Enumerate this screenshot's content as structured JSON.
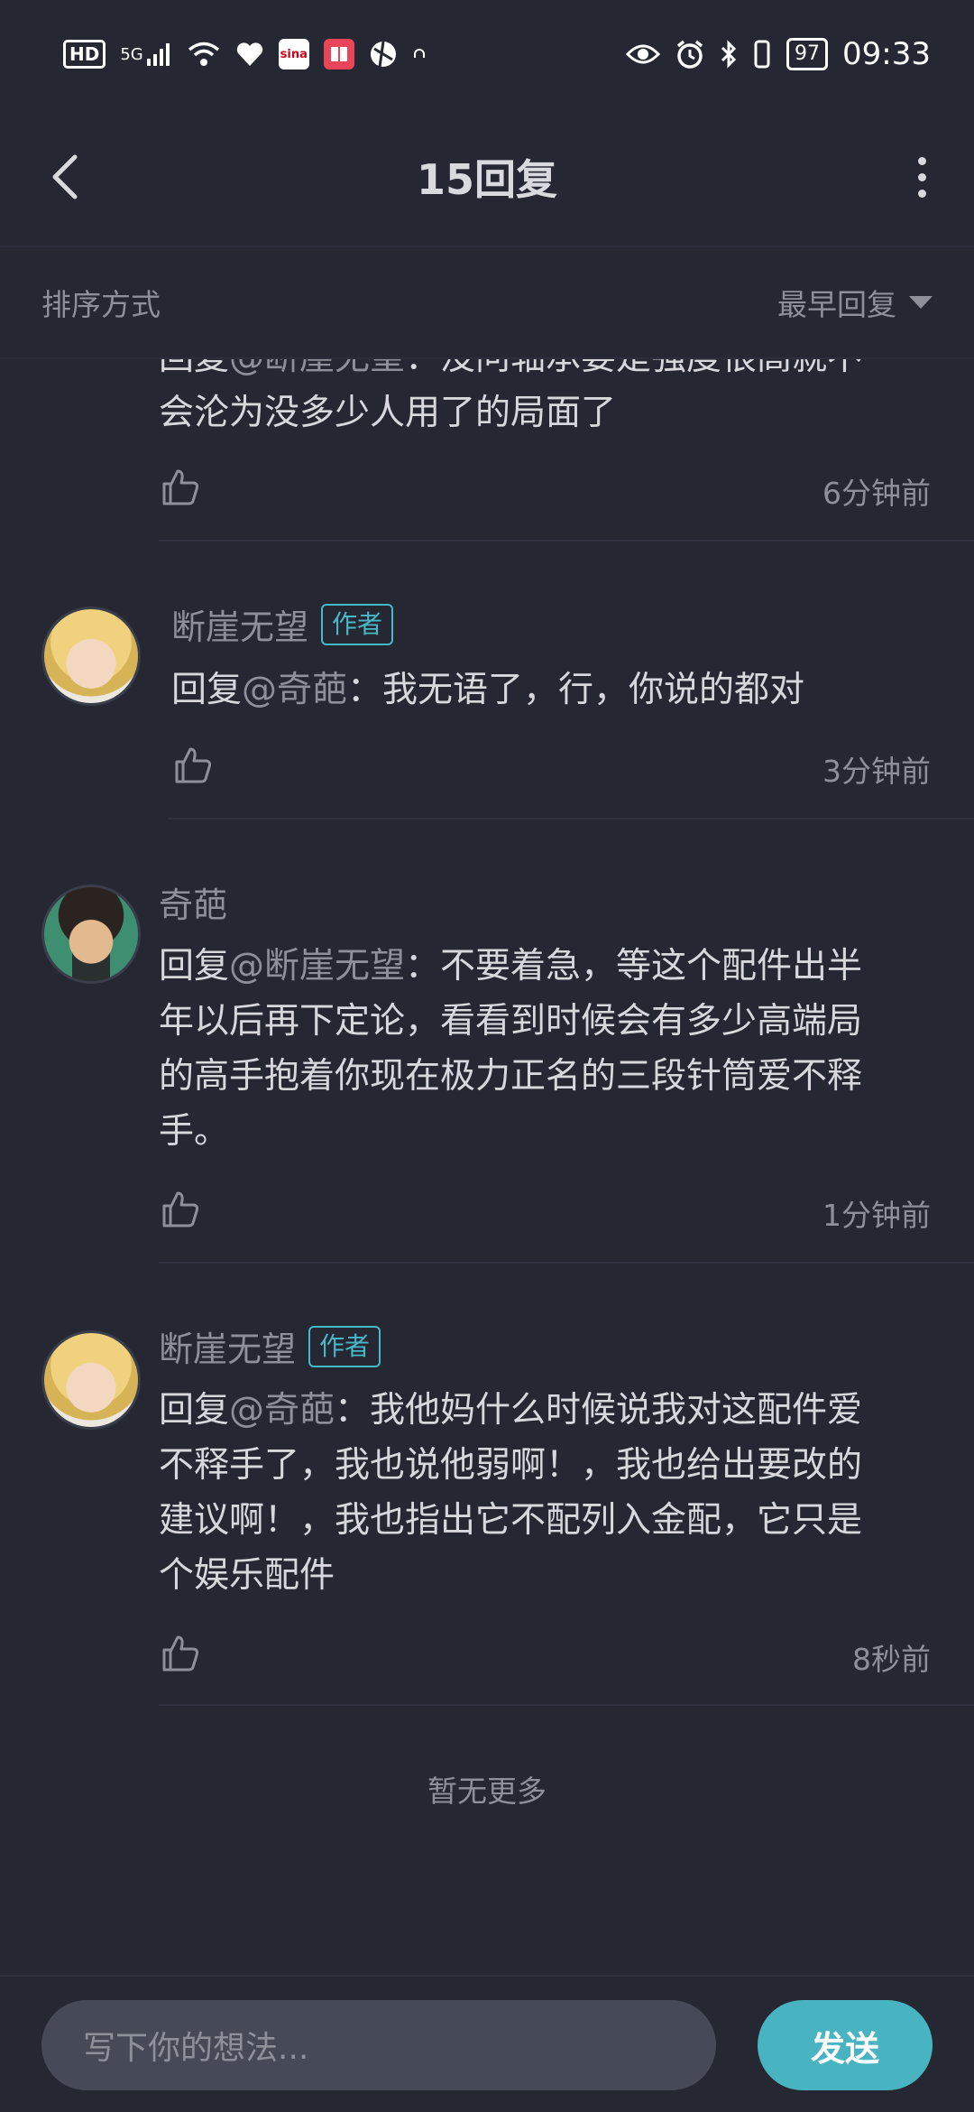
{
  "status_bar": {
    "hd": "HD",
    "signal": "5G",
    "app_sina": "sina",
    "battery": "97",
    "time": "09:33"
  },
  "header": {
    "title": "15回复"
  },
  "sort": {
    "label": "排序方式",
    "value": "最早回复"
  },
  "replies": [
    {
      "author": "",
      "prefix": "回复",
      "mention": "@断崖无望",
      "text_line1_partial": "：没问轴承要是强度很高就不",
      "text_rest": "会沦为没多少人用了的局面了",
      "time": "6分钟前"
    },
    {
      "author": "断崖无望",
      "tag": "作者",
      "prefix": "回复",
      "mention": "@奇葩",
      "text": "：我无语了，行，你说的都对",
      "time": "3分钟前"
    },
    {
      "author": "奇葩",
      "prefix": "回复",
      "mention": "@断崖无望",
      "text_l1": "：不要着急，等这个配件出半",
      "text_l2": "年以后再下定论，看看到时候会有多少高端局",
      "text_l3": "的高手抱着你现在极力正名的三段针筒爱不释",
      "text_l4": "手。",
      "time": "1分钟前"
    },
    {
      "author": "断崖无望",
      "tag": "作者",
      "prefix": "回复",
      "mention": "@奇葩",
      "text_l1": "：我他妈什么时候说我对这配件爱",
      "text_l2": "不释手了，我也说他弱啊！，我也给出要改的",
      "text_l3": "建议啊！，我也指出它不配列入金配，它只是",
      "text_l4": "个娱乐配件",
      "time": "8秒前"
    }
  ],
  "footer_text": "暂无更多",
  "composer": {
    "placeholder": "写下你的想法...",
    "send_label": "发送"
  },
  "colors": {
    "background": "#252733",
    "accent": "#49b4c1",
    "tag": "#48b7c6",
    "muted": "#8d8f99"
  }
}
